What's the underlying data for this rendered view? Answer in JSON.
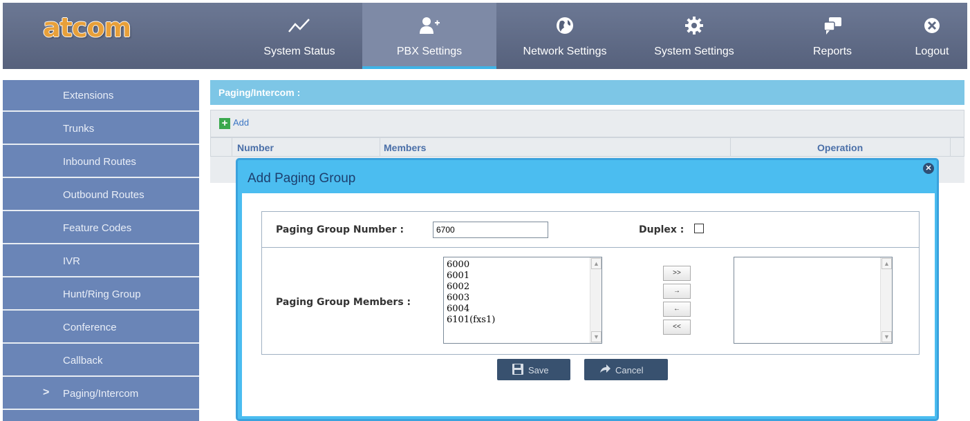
{
  "brand": {
    "logo_text": "atcom",
    "logo_color": "#e8a03a"
  },
  "topnav": {
    "items": [
      {
        "label": "System Status",
        "icon": "line-chart-icon",
        "active": false
      },
      {
        "label": "PBX Settings",
        "icon": "add-user-icon",
        "active": true
      },
      {
        "label": "Network Settings",
        "icon": "globe-icon",
        "active": false
      },
      {
        "label": "System Settings",
        "icon": "gear-icon",
        "active": false
      },
      {
        "label": "Reports",
        "icon": "chat-icon",
        "active": false
      },
      {
        "label": "Logout",
        "icon": "close-circle-icon",
        "active": false
      }
    ]
  },
  "sidebar": {
    "items": [
      {
        "label": "Extensions"
      },
      {
        "label": "Trunks"
      },
      {
        "label": "Inbound Routes"
      },
      {
        "label": "Outbound Routes"
      },
      {
        "label": "Feature Codes"
      },
      {
        "label": "IVR"
      },
      {
        "label": "Hunt/Ring Group"
      },
      {
        "label": "Conference"
      },
      {
        "label": "Callback"
      },
      {
        "label": "Paging/Intercom",
        "active": true,
        "marker": ">"
      }
    ]
  },
  "content": {
    "title": "Paging/Intercom :",
    "add_label": "Add",
    "columns": [
      "Number",
      "Members",
      "Operation"
    ]
  },
  "dialog": {
    "title": "Add Paging Group",
    "number_label": "Paging Group Number :",
    "number_value": "6700",
    "duplex_label": "Duplex :",
    "duplex_checked": false,
    "members_label": "Paging Group Members :",
    "available_members": [
      "6000",
      "6001",
      "6002",
      "6003",
      "6004",
      "6101(fxs1)"
    ],
    "selected_members": [],
    "move_buttons": {
      "add_all": ">>",
      "add_one": "→",
      "remove_one": "←",
      "remove_all": "<<"
    },
    "save_label": "Save",
    "cancel_label": "Cancel"
  },
  "colors": {
    "accent": "#3fb3e6",
    "sidebar_bg": "#6a85b7",
    "dialog_bg": "#4bbdf0",
    "button_bg": "#38516f"
  }
}
